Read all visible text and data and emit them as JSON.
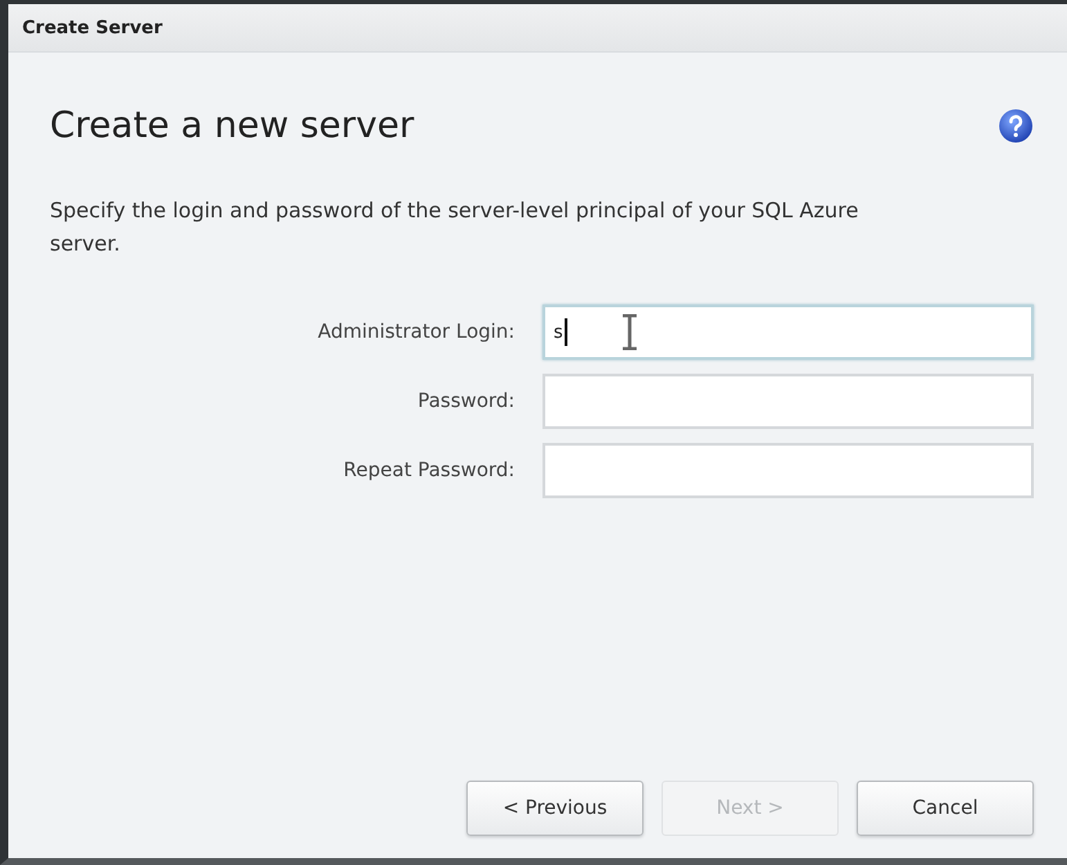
{
  "window": {
    "title": "Create Server"
  },
  "heading": "Create a new server",
  "description": "Specify the login and password of the server-level principal of your SQL Azure server.",
  "fields": [
    {
      "label": "Administrator Login:",
      "value": "s",
      "focused": true
    },
    {
      "label": "Password:",
      "focused": false
    },
    {
      "label": "Repeat Password:",
      "focused": false
    }
  ],
  "buttons": [
    {
      "label": "< Previous",
      "disabled": false
    },
    {
      "label": "Next >",
      "disabled": true
    },
    {
      "label": "Cancel",
      "disabled": false
    }
  ]
}
